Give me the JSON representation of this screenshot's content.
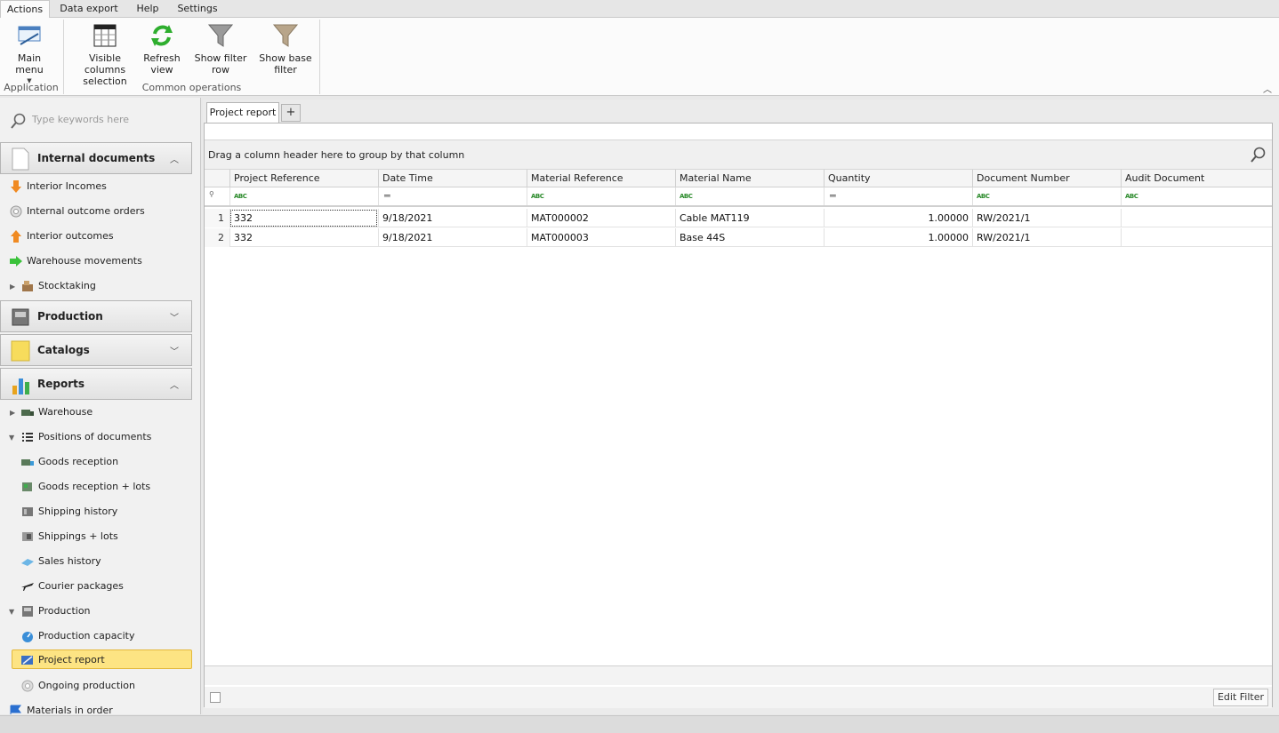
{
  "ribbon": {
    "tabs": [
      "Actions",
      "Data export",
      "Help",
      "Settings"
    ],
    "groups": {
      "application": {
        "label": "Application",
        "buttons": [
          {
            "label": "Main menu",
            "icon": "main-menu-icon"
          }
        ]
      },
      "common": {
        "label": "Common operations",
        "buttons": [
          {
            "label": "Visible columns selection",
            "icon": "table-columns-icon"
          },
          {
            "label": "Refresh view",
            "icon": "refresh-icon"
          },
          {
            "label": "Show filter row",
            "icon": "filter-icon"
          },
          {
            "label": "Show base filter",
            "icon": "base-filter-icon"
          }
        ]
      }
    }
  },
  "sidebar": {
    "search_placeholder": "Type keywords here",
    "groups": {
      "internal": {
        "label": "Internal documents",
        "items": [
          "Interior Incomes",
          "Internal outcome orders",
          "Interior outcomes",
          "Warehouse movements",
          "Stocktaking"
        ]
      },
      "production": {
        "label": "Production"
      },
      "catalogs": {
        "label": "Catalogs"
      },
      "reports": {
        "label": "Reports",
        "items": [
          "Warehouse",
          "Positions of documents",
          "Goods reception",
          "Goods reception + lots",
          "Shipping history",
          "Shippings + lots",
          "Sales history",
          "Courier packages",
          "Production",
          "Production capacity",
          "Project report",
          "Ongoing production",
          "Materials in order"
        ]
      }
    }
  },
  "document": {
    "tab_label": "Project report",
    "add_tab": "+",
    "group_hint": "Drag a column header here to group by that column",
    "columns": [
      "Project Reference",
      "Date Time",
      "Material Reference",
      "Material Name",
      "Quantity",
      "Document Number",
      "Audit Document"
    ],
    "rows": [
      {
        "n": "1",
        "cells": [
          "332",
          "9/18/2021",
          "MAT000002",
          "Cable MAT119",
          "1.00000",
          "RW/2021/1",
          ""
        ]
      },
      {
        "n": "2",
        "cells": [
          "332",
          "9/18/2021",
          "MAT000003",
          "Base 44S",
          "1.00000",
          "RW/2021/1",
          ""
        ]
      }
    ],
    "edit_filter": "Edit Filter"
  },
  "colors": {
    "selection": "#fde483",
    "selection_border": "#e3b83c"
  }
}
